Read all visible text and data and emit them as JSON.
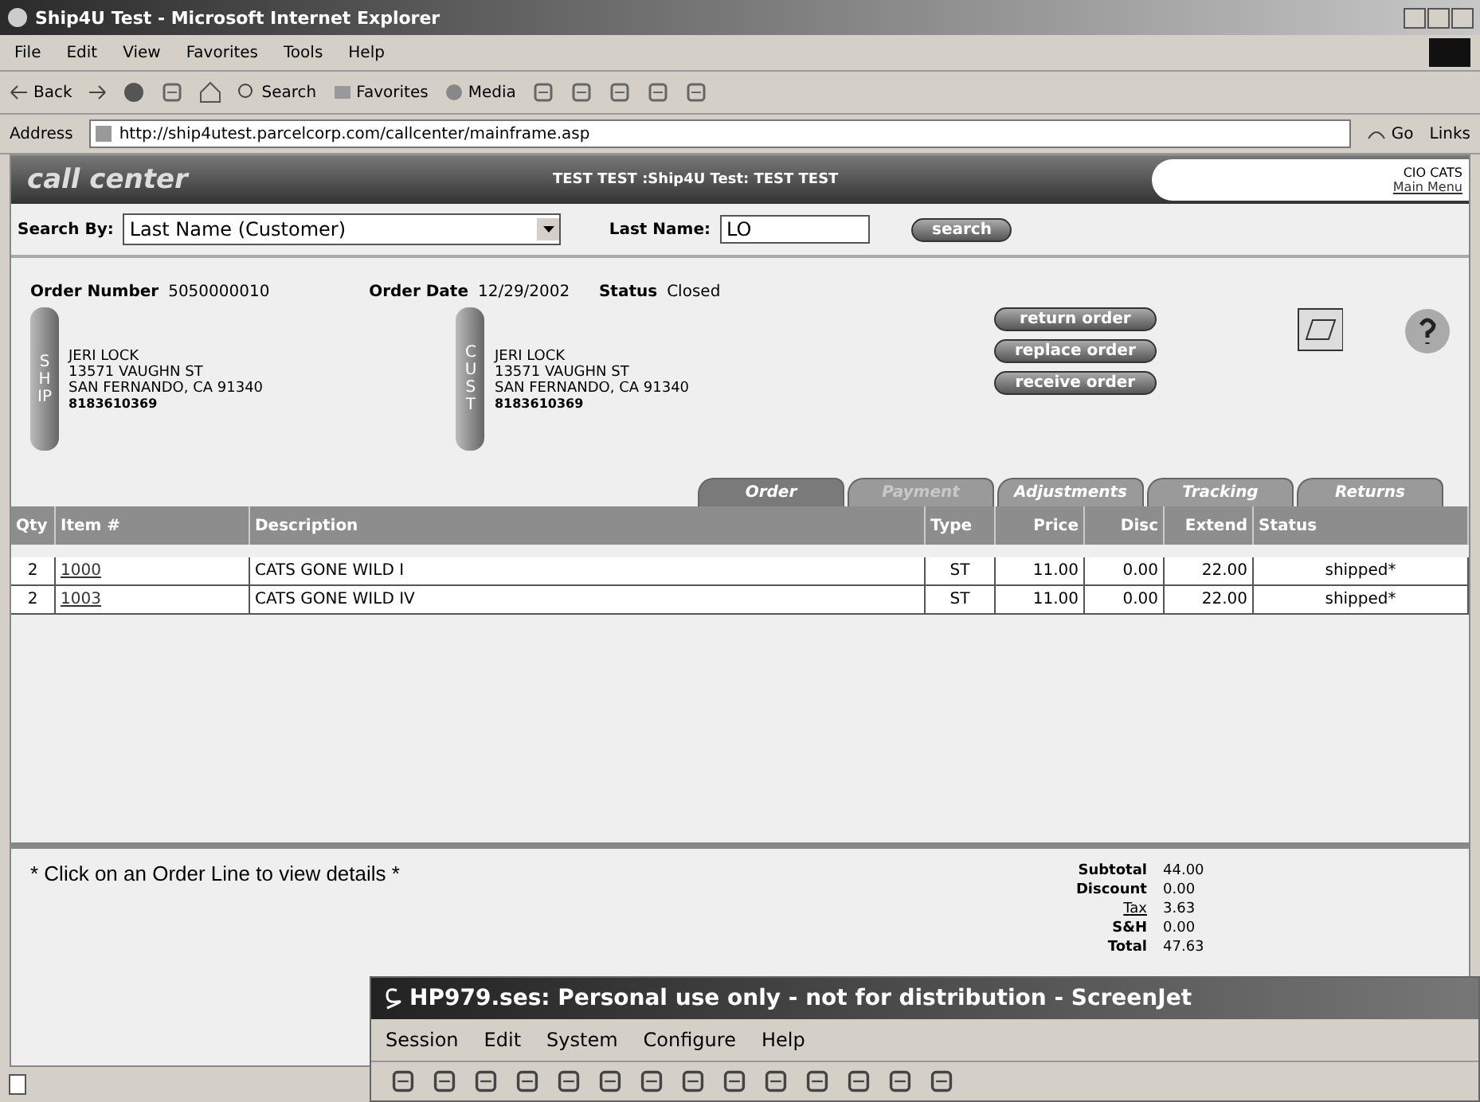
{
  "window": {
    "title": "Ship4U Test - Microsoft Internet Explorer"
  },
  "menu": [
    "File",
    "Edit",
    "View",
    "Favorites",
    "Tools",
    "Help"
  ],
  "toolbar": {
    "back": "Back",
    "search": "Search",
    "favorites": "Favorites",
    "media": "Media"
  },
  "address": {
    "label": "Address",
    "value": "http://ship4utest.parcelcorp.com/callcenter/mainframe.asp",
    "go": "Go",
    "links": "Links"
  },
  "header": {
    "logo": "call center",
    "title": "TEST TEST :Ship4U Test: TEST TEST",
    "user": "CIO CATS",
    "main_menu": "Main Menu"
  },
  "search": {
    "by_label": "Search By:",
    "by_value": "Last Name (Customer)",
    "name_label": "Last Name:",
    "name_value": "LO",
    "button": "search"
  },
  "order": {
    "number_label": "Order Number",
    "number": "5050000010",
    "date_label": "Order Date",
    "date": "12/29/2002",
    "status_label": "Status",
    "status": "Closed"
  },
  "addresses": [
    {
      "tag": "SHIP",
      "lines": [
        "JERI LOCK",
        "13571 VAUGHN ST",
        "SAN FERNANDO, CA 91340"
      ],
      "phone": "8183610369"
    },
    {
      "tag": "CUST",
      "lines": [
        "JERI LOCK",
        "13571 VAUGHN ST",
        "SAN FERNANDO, CA 91340"
      ],
      "phone": "8183610369"
    }
  ],
  "actions": [
    "return order",
    "replace order",
    "receive order"
  ],
  "tabs": [
    {
      "label": "Order",
      "selected": true,
      "disabled": false
    },
    {
      "label": "Payment",
      "selected": false,
      "disabled": true
    },
    {
      "label": "Adjustments",
      "selected": false,
      "disabled": false
    },
    {
      "label": "Tracking",
      "selected": false,
      "disabled": false
    },
    {
      "label": "Returns",
      "selected": false,
      "disabled": false
    }
  ],
  "table": {
    "columns": [
      "Qty",
      "Item #",
      "Description",
      "Type",
      "Price",
      "Disc",
      "Extend",
      "Status"
    ],
    "rows": [
      [
        "2",
        "1000",
        "CATS GONE WILD I",
        "ST",
        "11.00",
        "0.00",
        "22.00",
        "shipped*"
      ],
      [
        "2",
        "1003",
        "CATS GONE WILD IV",
        "ST",
        "11.00",
        "0.00",
        "22.00",
        "shipped*"
      ]
    ]
  },
  "hint": "* Click on an Order Line to view details *",
  "totals": [
    {
      "label": "Subtotal",
      "value": "44.00",
      "link": false
    },
    {
      "label": "Discount",
      "value": "0.00",
      "link": false
    },
    {
      "label": "Tax",
      "value": "3.63",
      "link": true
    },
    {
      "label": "S&H",
      "value": "0.00",
      "link": false
    },
    {
      "label": "Total",
      "value": "47.63",
      "link": false
    }
  ],
  "screenjet": {
    "title": "HP979.ses: Personal use only - not for distribution - ScreenJet",
    "menu": [
      "Session",
      "Edit",
      "System",
      "Configure",
      "Help"
    ]
  }
}
